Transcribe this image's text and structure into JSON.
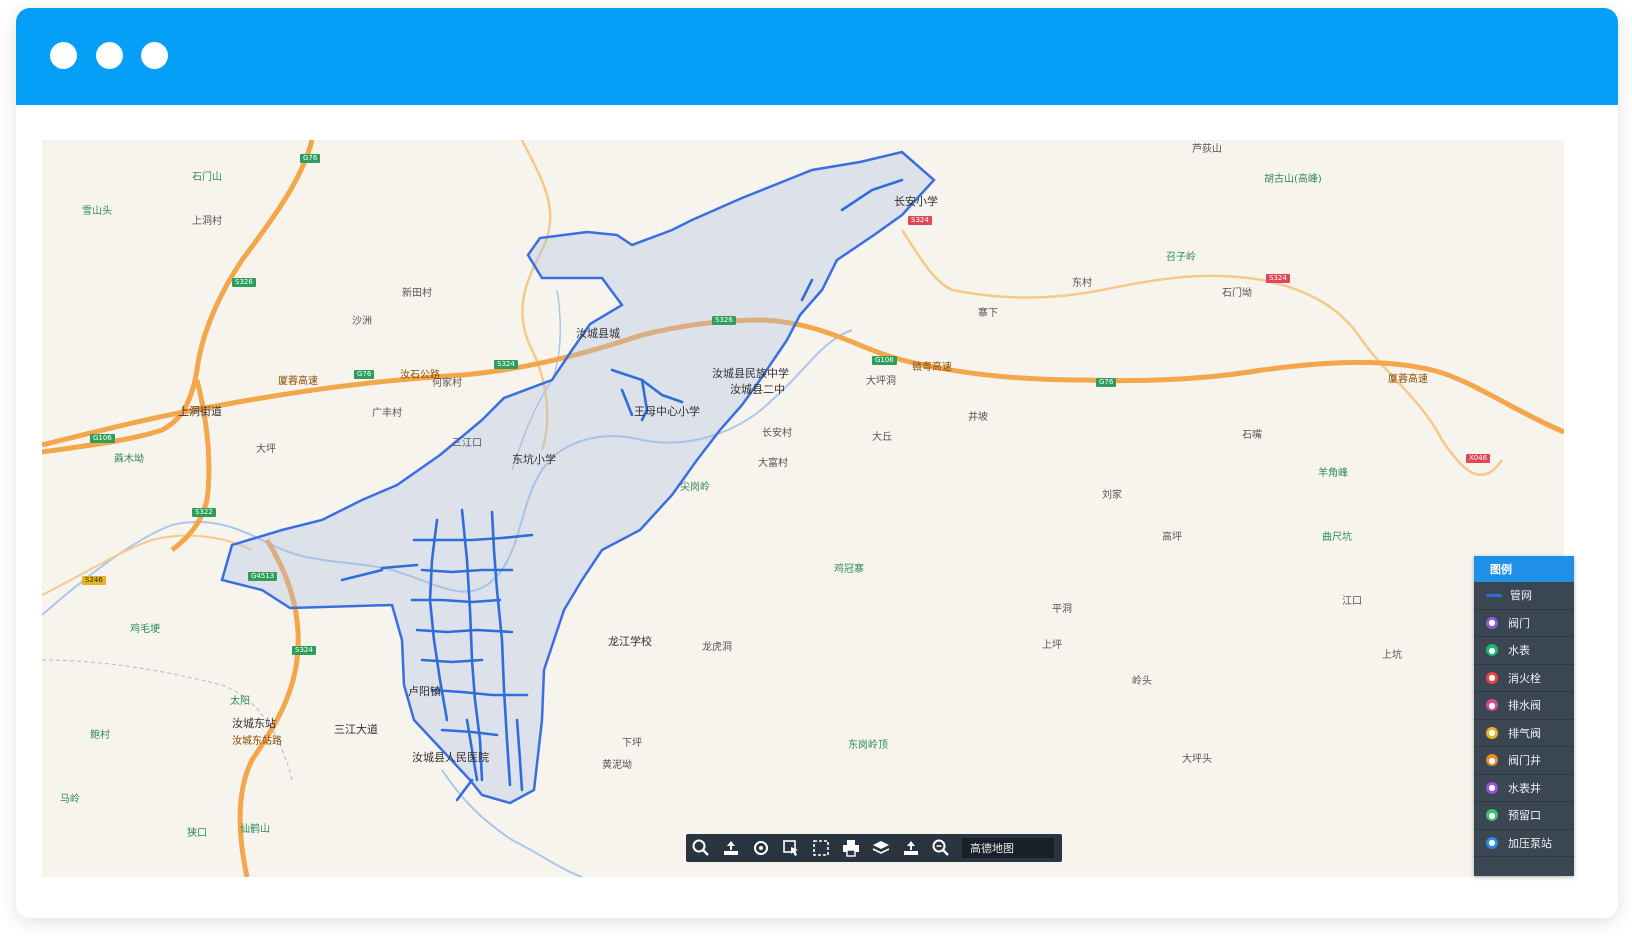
{
  "window": {
    "titlebar_color": "#069ff8",
    "controls": [
      "window-dot-icon",
      "window-dot-icon",
      "window-dot-icon"
    ]
  },
  "map": {
    "places": [
      {
        "text": "石门山",
        "kind": "mountain"
      },
      {
        "text": "雪山头",
        "kind": "mountain"
      },
      {
        "text": "蔴木坳",
        "kind": "mountain"
      },
      {
        "text": "鸡毛埂",
        "kind": "mountain"
      },
      {
        "text": "太阳",
        "kind": "mountain"
      },
      {
        "text": "鲍村",
        "kind": "mountain"
      },
      {
        "text": "马岭",
        "kind": "mountain"
      },
      {
        "text": "狭口",
        "kind": "mountain"
      },
      {
        "text": "仙鹤山",
        "kind": "mountain"
      },
      {
        "text": "尖岗岭",
        "kind": "mountain"
      },
      {
        "text": "鸡冠寨",
        "kind": "mountain"
      },
      {
        "text": "东岗岭顶",
        "kind": "mountain"
      },
      {
        "text": "召子岭",
        "kind": "mountain"
      },
      {
        "text": "胡古山(高峰)",
        "kind": "mountain"
      },
      {
        "text": "羊角峰",
        "kind": "mountain"
      },
      {
        "text": "曲尺坑",
        "kind": "mountain"
      },
      {
        "text": "芦荻山",
        "kind": "place"
      },
      {
        "text": "汝城县城",
        "kind": "major"
      },
      {
        "text": "上洞街道",
        "kind": "major"
      },
      {
        "text": "汝城县人民医院",
        "kind": "major"
      },
      {
        "text": "卢阳镇",
        "kind": "major"
      },
      {
        "text": "汝城县民族中学",
        "kind": "major"
      },
      {
        "text": "汝城县二中",
        "kind": "major"
      },
      {
        "text": "龙江学校",
        "kind": "major"
      },
      {
        "text": "东坑小学",
        "kind": "major"
      },
      {
        "text": "长安小学",
        "kind": "major"
      },
      {
        "text": "王母中心小学",
        "kind": "major"
      },
      {
        "text": "三江大道",
        "kind": "major"
      },
      {
        "text": "汝城东站",
        "kind": "major"
      },
      {
        "text": "大坪",
        "kind": "place"
      },
      {
        "text": "上洞村",
        "kind": "place"
      },
      {
        "text": "广丰村",
        "kind": "place"
      },
      {
        "text": "何家村",
        "kind": "place"
      },
      {
        "text": "新田村",
        "kind": "place"
      },
      {
        "text": "沙洲",
        "kind": "place"
      },
      {
        "text": "三江口",
        "kind": "place"
      },
      {
        "text": "下坪",
        "kind": "place"
      },
      {
        "text": "大丘",
        "kind": "place"
      },
      {
        "text": "井坡",
        "kind": "place"
      },
      {
        "text": "大坪洞",
        "kind": "place"
      },
      {
        "text": "寨下",
        "kind": "place"
      },
      {
        "text": "东村",
        "kind": "place"
      },
      {
        "text": "石门坳",
        "kind": "place"
      },
      {
        "text": "大富村",
        "kind": "place"
      },
      {
        "text": "长安村",
        "kind": "place"
      },
      {
        "text": "上坪",
        "kind": "place"
      },
      {
        "text": "刘家",
        "kind": "place"
      },
      {
        "text": "黄泥坳",
        "kind": "place"
      },
      {
        "text": "岭头",
        "kind": "place"
      },
      {
        "text": "高坪",
        "kind": "place"
      },
      {
        "text": "龙虎洞",
        "kind": "place"
      },
      {
        "text": "平洞",
        "kind": "place"
      },
      {
        "text": "大坪头",
        "kind": "place"
      },
      {
        "text": "江口",
        "kind": "place"
      },
      {
        "text": "石嘴",
        "kind": "place"
      },
      {
        "text": "上坑",
        "kind": "place"
      }
    ],
    "roads": [
      {
        "text": "厦蓉高速",
        "kind": "road"
      },
      {
        "text": "汝城东站路",
        "kind": "road"
      },
      {
        "text": "赣粤高速",
        "kind": "road"
      },
      {
        "text": "汝石公路",
        "kind": "road"
      },
      {
        "text": "厦蓉高速",
        "kind": "road"
      }
    ],
    "shields": [
      "G76",
      "S326",
      "G106",
      "S322",
      "G4513",
      "S324",
      "G76",
      "S324",
      "S326",
      "G106",
      "G76",
      "S324",
      "S324",
      "X046",
      "S246"
    ]
  },
  "toolbar": {
    "tools": [
      "search-icon",
      "upload-icon",
      "locate-icon",
      "select-icon",
      "frame-icon",
      "print-icon",
      "layers-icon",
      "export-icon",
      "zoom-icon"
    ],
    "basemap_label": "高德地图"
  },
  "legend": {
    "title": "图例",
    "items": [
      {
        "label": "管网",
        "kind": "line",
        "color": "#2f6ed8",
        "icon": "pipe-line-icon"
      },
      {
        "label": "阀门",
        "kind": "dot",
        "color": "#8e5bd6",
        "icon": "valve-icon"
      },
      {
        "label": "水表",
        "kind": "dot",
        "color": "#1fb36b",
        "icon": "water-meter-icon"
      },
      {
        "label": "消火栓",
        "kind": "dot",
        "color": "#e8463c",
        "icon": "hydrant-icon"
      },
      {
        "label": "排水阀",
        "kind": "dot",
        "color": "#d84a9c",
        "icon": "drain-valve-icon"
      },
      {
        "label": "排气阀",
        "kind": "dot",
        "color": "#e8b320",
        "icon": "air-valve-icon"
      },
      {
        "label": "阀门井",
        "kind": "dot",
        "color": "#e88a2a",
        "icon": "valve-well-icon"
      },
      {
        "label": "水表井",
        "kind": "dot",
        "color": "#9a4fd8",
        "icon": "meter-well-icon"
      },
      {
        "label": "预留口",
        "kind": "dot",
        "color": "#3cbf76",
        "icon": "reserved-port-icon"
      },
      {
        "label": "加压泵站",
        "kind": "dot",
        "color": "#2a8ae0",
        "icon": "pump-station-icon"
      }
    ]
  }
}
